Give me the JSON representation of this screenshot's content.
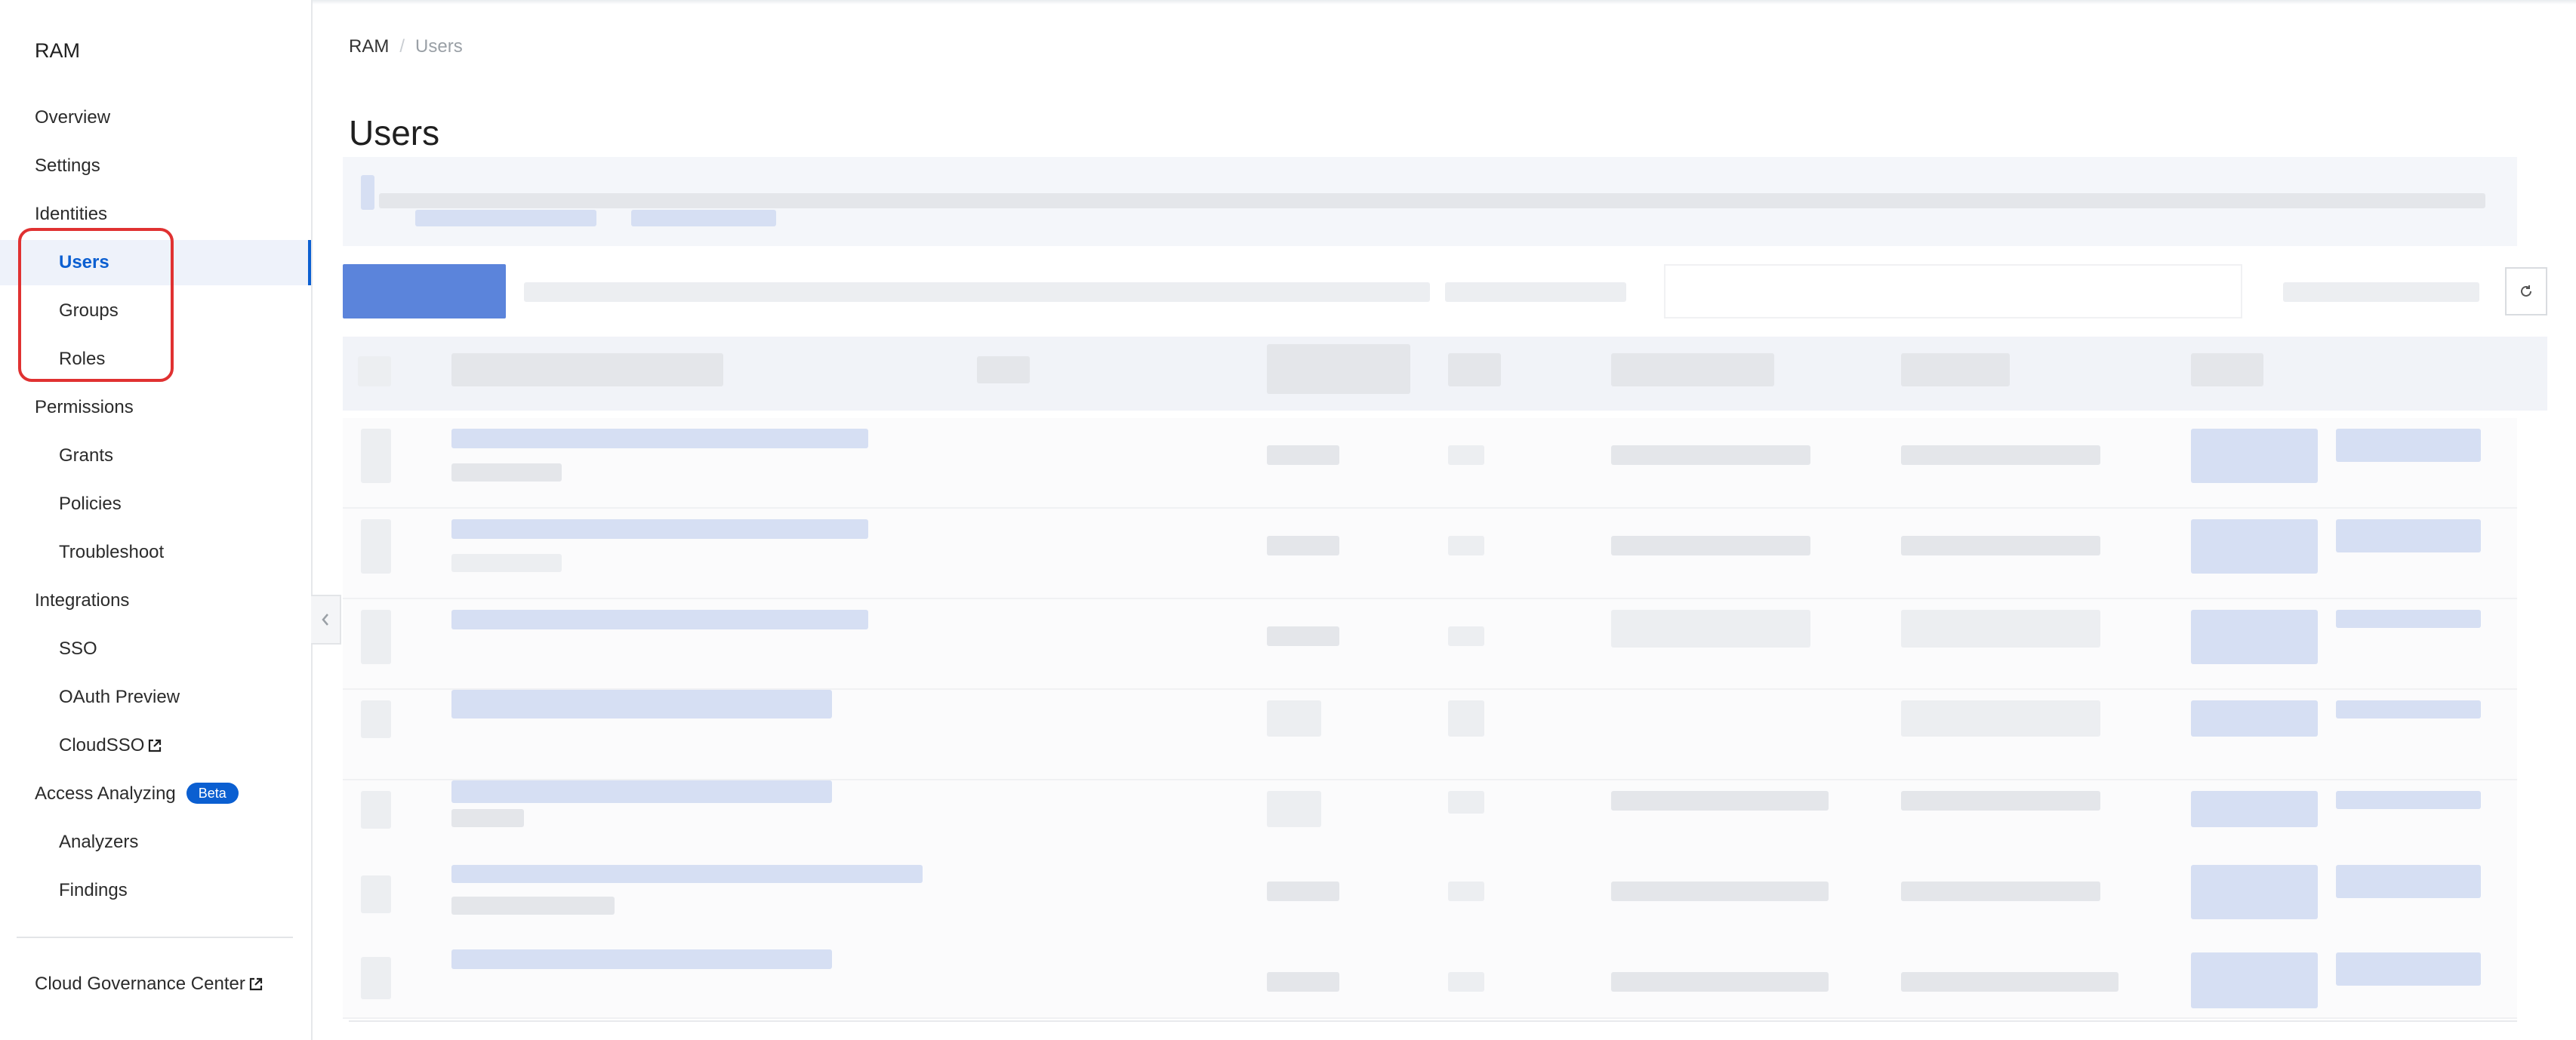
{
  "sidebar": {
    "title": "RAM",
    "items": [
      {
        "label": "Overview",
        "level": 1,
        "active": false
      },
      {
        "label": "Settings",
        "level": 1,
        "active": false
      },
      {
        "label": "Identities",
        "level": 1,
        "active": false
      },
      {
        "label": "Users",
        "level": 2,
        "active": true
      },
      {
        "label": "Groups",
        "level": 2,
        "active": false
      },
      {
        "label": "Roles",
        "level": 2,
        "active": false
      },
      {
        "label": "Permissions",
        "level": 1,
        "active": false
      },
      {
        "label": "Grants",
        "level": 2,
        "active": false
      },
      {
        "label": "Policies",
        "level": 2,
        "active": false
      },
      {
        "label": "Troubleshoot",
        "level": 2,
        "active": false
      },
      {
        "label": "Integrations",
        "level": 1,
        "active": false
      },
      {
        "label": "SSO",
        "level": 2,
        "active": false
      },
      {
        "label": "OAuth Preview",
        "level": 2,
        "active": false
      },
      {
        "label": "CloudSSO",
        "level": 2,
        "active": false,
        "external": true
      },
      {
        "label": "Access Analyzing",
        "level": 1,
        "active": false,
        "badge": "Beta"
      },
      {
        "label": "Analyzers",
        "level": 2,
        "active": false
      },
      {
        "label": "Findings",
        "level": 2,
        "active": false
      }
    ],
    "footer_link": "Cloud Governance Center"
  },
  "breadcrumb": {
    "root": "RAM",
    "separator": "/",
    "current": "Users"
  },
  "page_title": "Users",
  "colors": {
    "accent": "#0b5fd1",
    "highlight": "#e03131",
    "blur_blue": "#d6dff3",
    "button": "#5b84db"
  },
  "icons": {
    "external": "external-link-icon",
    "refresh": "refresh-icon",
    "collapse": "chevron-left-icon"
  }
}
